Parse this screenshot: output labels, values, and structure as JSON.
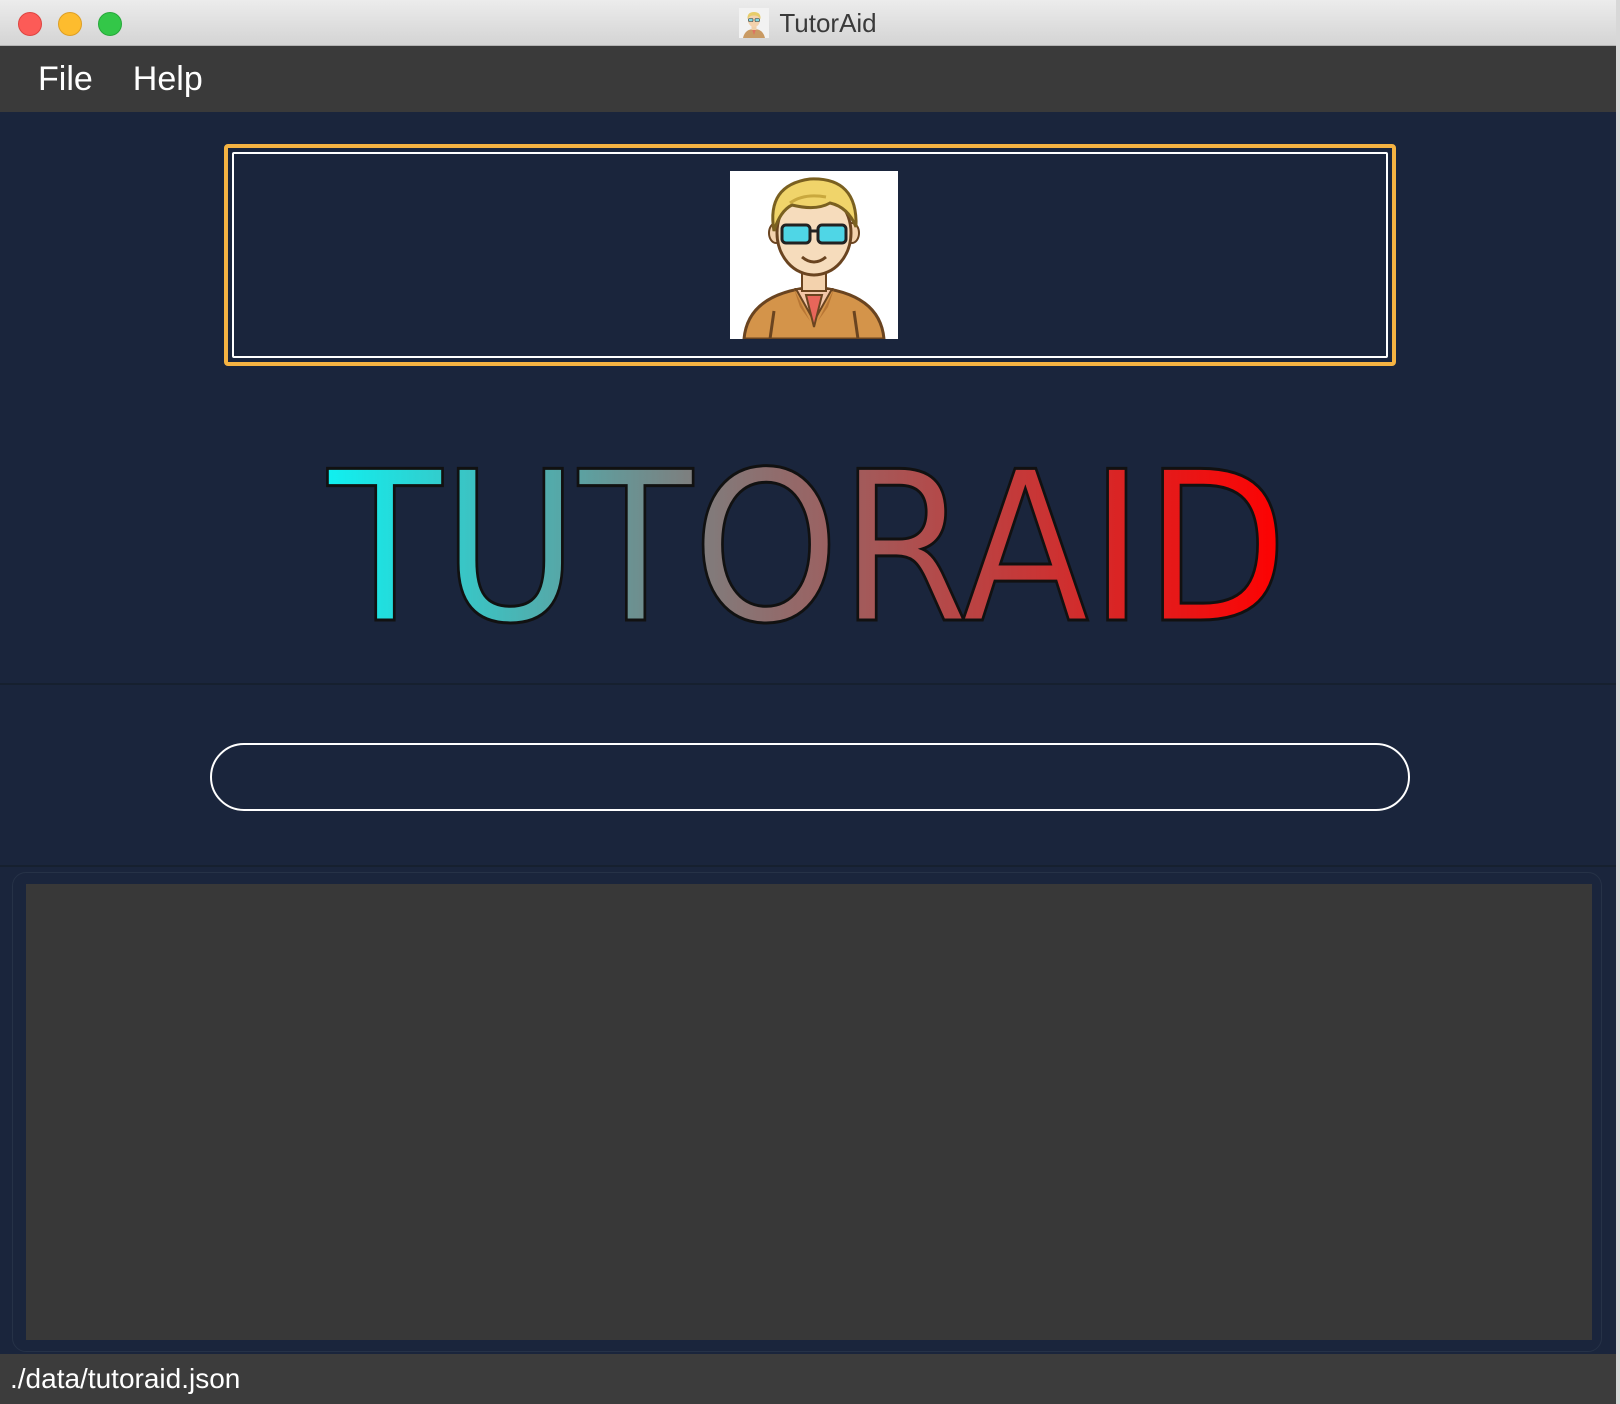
{
  "window": {
    "title": "TutorAid",
    "app_icon": "tutor-avatar-icon"
  },
  "menu": {
    "items": [
      {
        "label": "File"
      },
      {
        "label": "Help"
      }
    ]
  },
  "banner": {
    "avatar": "tutor-avatar-icon",
    "border_color": "#f5b342"
  },
  "logo": {
    "text": "TUTORAID",
    "gradient_start": "#10f0f0",
    "gradient_end": "#ff0000"
  },
  "command": {
    "value": "",
    "placeholder": ""
  },
  "result": {
    "text": ""
  },
  "status": {
    "save_location": "./data/tutoraid.json"
  },
  "colors": {
    "background": "#1a253c",
    "menu_bar": "#3a3a3a",
    "result_panel": "#383838",
    "accent": "#f5b342"
  }
}
